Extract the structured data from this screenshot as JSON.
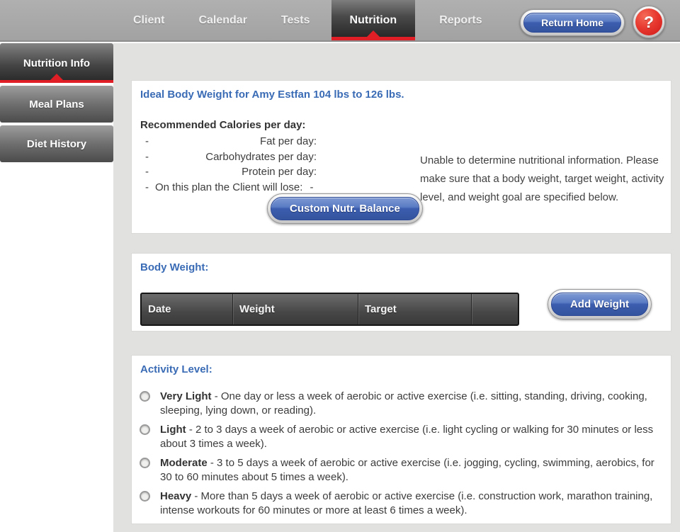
{
  "nav": {
    "tabs": [
      {
        "label": "Client",
        "active": false
      },
      {
        "label": "Calendar",
        "active": false
      },
      {
        "label": "Tests",
        "active": false
      },
      {
        "label": "Nutrition",
        "active": true
      },
      {
        "label": "Reports",
        "active": false
      }
    ],
    "return_home_label": "Return Home",
    "help_label": "?"
  },
  "sidebar": {
    "items": [
      {
        "label": "Nutrition Info",
        "active": true
      },
      {
        "label": "Meal Plans",
        "active": false
      },
      {
        "label": "Diet History",
        "active": false
      }
    ]
  },
  "ideal_panel": {
    "title": "Ideal Body Weight for Amy Estfan 104 lbs to 126 lbs.",
    "calories_heading": "Recommended Calories per day:",
    "rows": [
      {
        "value": "-",
        "label": "Fat per day:"
      },
      {
        "value": "-",
        "label": "Carbohydrates per day:"
      },
      {
        "value": "-",
        "label": "Protein per day:"
      }
    ],
    "lose_row": {
      "prefix": "-",
      "label": "On this plan the Client will lose:",
      "value": "-"
    },
    "custom_button_label": "Custom Nutr. Balance",
    "note": "Unable to determine nutritional information. Please make sure that a body weight, target weight, activity level, and weight goal are specified below."
  },
  "body_weight_panel": {
    "title": "Body Weight:",
    "columns": [
      "Date",
      "Weight",
      "Target",
      ""
    ],
    "rows": [],
    "add_button_label": "Add Weight"
  },
  "activity_panel": {
    "title": "Activity Level:",
    "separator": " - ",
    "options": [
      {
        "name": "Very Light",
        "selected": false,
        "description": "One day or less a week of aerobic or active exercise (i.e. sitting, standing, driving, cooking, sleeping, lying down, or reading)."
      },
      {
        "name": "Light",
        "selected": false,
        "description": "2 to 3 days a week of aerobic or active exercise (i.e. light cycling or walking for 30 minutes or less about 3 times a week)."
      },
      {
        "name": "Moderate",
        "selected": false,
        "description": "3 to 5 days a week of aerobic or active exercise (i.e. jogging, cycling, swimming, aerobics, for 30 to 60 minutes about 5 times a week)."
      },
      {
        "name": "Heavy",
        "selected": false,
        "description": "More than 5 days a week of aerobic or active exercise (i.e. construction work, marathon training, intense workouts for 60 minutes or more at least 6 times a week)."
      }
    ]
  },
  "colors": {
    "accent_red": "#e01e25",
    "button_blue": "#3c5dae",
    "heading_blue": "#3a6bb5",
    "nav_gray": "#a8a8a8",
    "content_bg": "#e1e1df"
  }
}
